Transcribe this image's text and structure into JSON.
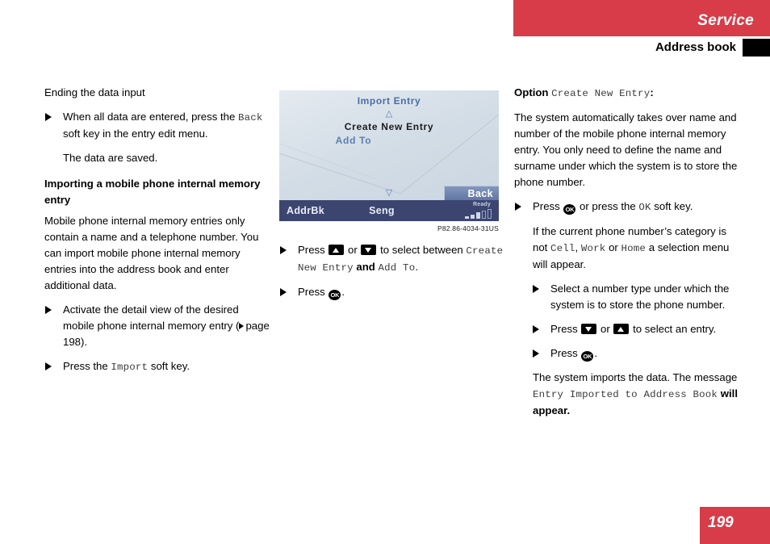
{
  "header": {
    "chapter": "Service",
    "section": "Address book"
  },
  "footer": {
    "page_number": "199"
  },
  "colors": {
    "accent_red": "#d83c49",
    "screen_blue": "#4a6ea8",
    "statusbar": "#3b4570"
  },
  "left_column": {
    "heading": "Ending the data input",
    "bullet1_a": "When all data are entered, press the ",
    "bullet1_mono": "Back",
    "bullet1_b": " soft key in the entry edit menu.",
    "bullet1_note": "The data are saved.",
    "subheading": "Importing a mobile phone internal memory entry",
    "paragraph": "Mobile phone internal memory entries only contain a name and a telephone number. You can import mobile phone internal memory entries into the address book and enter additional data.",
    "bullet2_a": "Activate the detail view of the desired mobile phone internal memory entry (",
    "bullet2_ref": "page 198",
    "bullet2_b": ").",
    "bullet3_a": "Press the ",
    "bullet3_mono": "Import",
    "bullet3_b": " soft key."
  },
  "device_screen": {
    "title": "Import Entry",
    "scroll_up": "△",
    "scroll_down": "▽",
    "item_selected": "Create New Entry",
    "item_other": "Add To",
    "softkey_back": "Back",
    "status_left": "AddrBk",
    "status_center": "Seng",
    "status_ready": "Ready",
    "caption": "P82.86-4034-31US"
  },
  "mid_column": {
    "bullet1_a": "Press ",
    "bullet1_key_up": "up-arrow-key",
    "bullet1_or": " or ",
    "bullet1_key_down": "down-arrow-key",
    "bullet1_b": " to select between ",
    "bullet1_mono1": "Create New Entry",
    "bullet1_and": " and ",
    "bullet1_mono2": "Add To",
    "bullet1_c": ".",
    "bullet2_a": "Press ",
    "bullet2_ok": "OK",
    "bullet2_b": "."
  },
  "right_column": {
    "option_label": "Option ",
    "option_mono": "Create New Entry",
    "option_colon": ":",
    "paragraph1": "The system automatically takes over name and number of the mobile phone internal memory entry. You only need to define the name and surname under which the system is to store the phone number.",
    "bullet1_a": "Press ",
    "bullet1_ok": "OK",
    "bullet1_b": " or press the ",
    "bullet1_mono": "OK",
    "bullet1_c": " soft key.",
    "paragraph2_a": "If the current phone number’s category is not ",
    "paragraph2_mono1": "Cell",
    "paragraph2_sep1": ", ",
    "paragraph2_mono2": "Work",
    "paragraph2_sep2": " or ",
    "paragraph2_mono3": "Home",
    "paragraph2_b": " a selection menu will appear.",
    "bullet2": "Select a number type under which the system is to store the phone number.",
    "bullet3_a": "Press ",
    "bullet3_key_down": "down-arrow-key",
    "bullet3_or": " or ",
    "bullet3_key_up": "up-arrow-key",
    "bullet3_b": " to select an entry.",
    "bullet4_a": "Press ",
    "bullet4_ok": "OK",
    "bullet4_b": ".",
    "paragraph3_a": "The system imports the data. The message ",
    "paragraph3_mono": "Entry Imported to Address Book",
    "paragraph3_b": " will appear."
  }
}
